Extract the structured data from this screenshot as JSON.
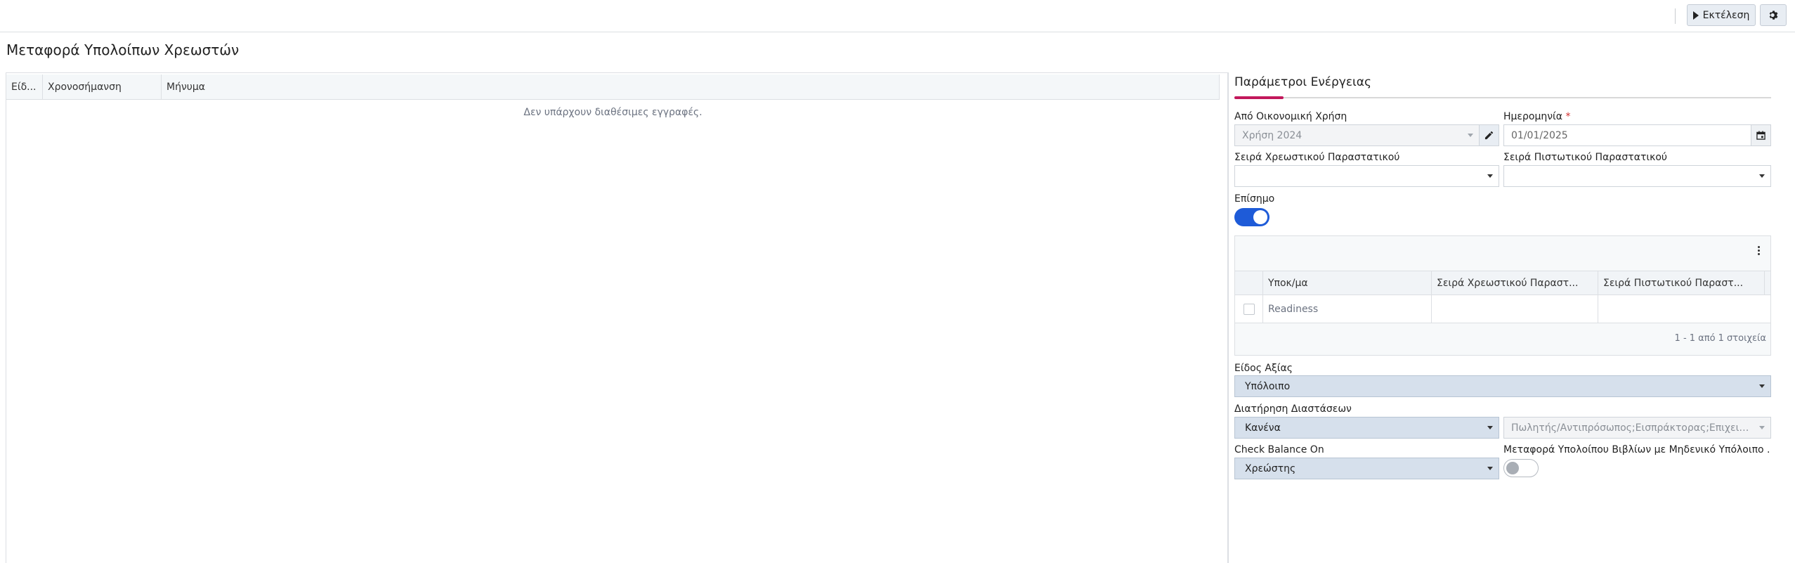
{
  "toolbar": {
    "run_label": "Εκτέλεση"
  },
  "page": {
    "title": "Μεταφορά Υπολοίπων Χρεωστών"
  },
  "log_grid": {
    "columns": [
      "Είδ...",
      "Χρονοσήμανση",
      "Μήνυμα"
    ],
    "empty_text": "Δεν υπάρχουν διαθέσιμες εγγραφές."
  },
  "panel": {
    "title": "Παράμετροι Ενέργειας",
    "fiscal_year": {
      "label": "Από Οικονομική Χρήση",
      "value": "Χρήση 2024"
    },
    "date": {
      "label": "Ημερομηνία",
      "required_mark": "*",
      "value": "01/01/2025"
    },
    "debit_series": {
      "label": "Σειρά Χρεωστικού Παραστατικού",
      "value": ""
    },
    "credit_series": {
      "label": "Σειρά Πιστωτικού Παραστατικού",
      "value": ""
    },
    "official": {
      "label": "Επίσημο",
      "on": true
    },
    "branches_grid": {
      "columns": [
        "Υποκ/μα",
        "Σειρά Χρεωστικού Παραστ...",
        "Σειρά Πιστωτικού Παραστ..."
      ],
      "rows": [
        {
          "branch": "Readiness",
          "debit": "",
          "credit": ""
        }
      ],
      "footer": "1 - 1 από 1 στοιχεία"
    },
    "value_type": {
      "label": "Είδος Αξίας",
      "value": "Υπόλοιπο"
    },
    "keep_dimensions": {
      "label": "Διατήρηση Διαστάσεων",
      "value": "Κανένα",
      "dimensions_value": "Πωλητής/Αντιπρόσωπος;Εισπράκτορας;Επιχειρη..."
    },
    "check_balance": {
      "label": "Check Balance On",
      "value": "Χρεώστης"
    },
    "zero_balance": {
      "label": "Μεταφορά Υπολοίπου Βιβλίων με Μηδενικό Υπόλοιπο ...",
      "on": false
    }
  }
}
